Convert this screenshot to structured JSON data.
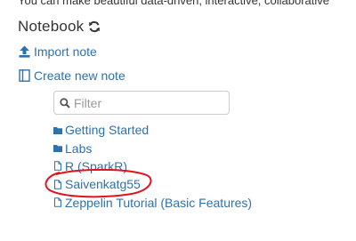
{
  "top_text": "You can make beautiful data-driven, interactive, collaborative",
  "notebook": {
    "title": "Notebook",
    "refresh_icon": "refresh-icon"
  },
  "actions": {
    "import_label": "Import note",
    "import_icon": "upload-icon",
    "create_label": "Create new note",
    "create_icon": "notebook-icon"
  },
  "filter": {
    "placeholder": "Filter",
    "value": ""
  },
  "notes": [
    {
      "label": "Getting Started",
      "type": "folder"
    },
    {
      "label": "Labs",
      "type": "folder"
    },
    {
      "label": "R (SparkR)",
      "type": "file"
    },
    {
      "label": "Saivenkatg55",
      "type": "file"
    },
    {
      "label": "Zeppelin Tutorial (Basic Features)",
      "type": "file"
    }
  ],
  "colors": {
    "link": "#3071a9",
    "annotation": "#e0131d",
    "text": "#333333"
  }
}
